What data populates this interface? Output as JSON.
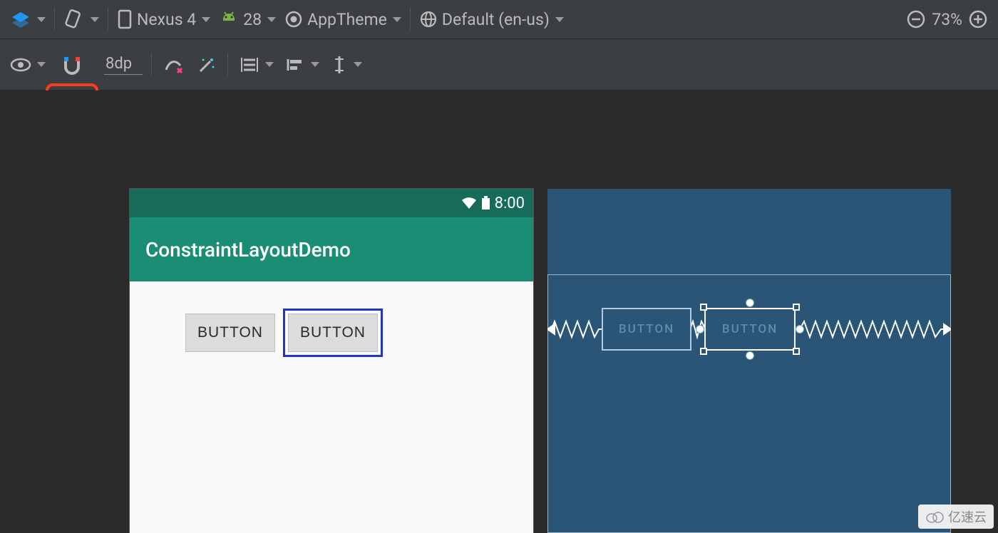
{
  "toolbar": {
    "device": "Nexus 4",
    "api": "28",
    "theme": "AppTheme",
    "locale": "Default (en-us)",
    "zoom": "73%"
  },
  "toolbar2": {
    "margin": "8dp"
  },
  "preview": {
    "clock": "8:00",
    "appTitle": "ConstraintLayoutDemo",
    "button1": "BUTTON",
    "button2": "BUTTON"
  },
  "blueprint": {
    "button1": "BUTTON",
    "button2": "BUTTON"
  },
  "watermark": "亿速云",
  "colors": {
    "accent": "#1c8d75",
    "statusbar": "#166b59",
    "blueprint": "#2a5576",
    "selection": "#2233cc"
  }
}
